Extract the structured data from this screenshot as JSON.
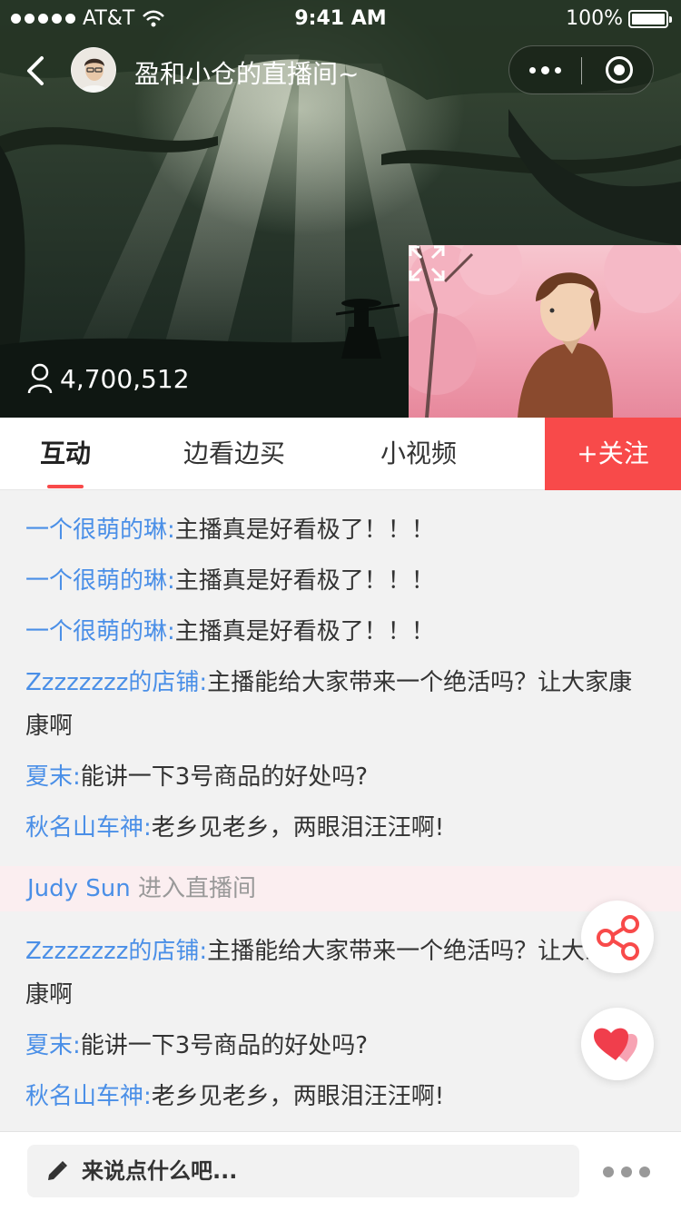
{
  "status_bar": {
    "carrier": "AT&T",
    "time": "9:41 AM",
    "battery": "100%"
  },
  "header": {
    "room_title": "盈和小仓的直播间~",
    "viewer_count": "4,700,512"
  },
  "tabs": [
    {
      "label": "互动",
      "active": true
    },
    {
      "label": "边看边买",
      "active": false
    },
    {
      "label": "小视频",
      "active": false
    }
  ],
  "follow_button": "+关注",
  "chat": {
    "messages_top": [
      {
        "user": "一个很萌的琳:",
        "text": "主播真是好看极了！！！"
      },
      {
        "user": "一个很萌的琳:",
        "text": "主播真是好看极了！！！"
      },
      {
        "user": "一个很萌的琳:",
        "text": "主播真是好看极了！！！"
      },
      {
        "user": "Zzzzzzzz的店铺:",
        "text": "主播能给大家带来一个绝活吗？让大家康康啊"
      },
      {
        "user": "夏末:",
        "text": "能讲一下3号商品的好处吗?"
      },
      {
        "user": "秋名山车神:",
        "text": "老乡见老乡，两眼泪汪汪啊!"
      }
    ],
    "enter_notice": {
      "user": "Judy Sun",
      "text": "进入直播间"
    },
    "messages_bottom": [
      {
        "user": "Zzzzzzzz的店铺:",
        "text": "主播能给大家带来一个绝活吗？让大家康康啊"
      },
      {
        "user": "夏末:",
        "text": "能讲一下3号商品的好处吗?"
      },
      {
        "user": "秋名山车神:",
        "text": "老乡见老乡，两眼泪汪汪啊!"
      }
    ]
  },
  "bottom_bar": {
    "input_placeholder": "来说点什么吧..."
  },
  "colors": {
    "accent_red": "#f84a4a",
    "username_blue": "#4a8fe7",
    "enter_bg": "#fbeef0"
  },
  "icons": [
    "back-arrow-icon",
    "more-dots-icon",
    "close-circle-icon",
    "user-icon",
    "fullscreen-icon",
    "share-icon",
    "heart-icon",
    "pen-icon",
    "ellipsis-icon"
  ]
}
